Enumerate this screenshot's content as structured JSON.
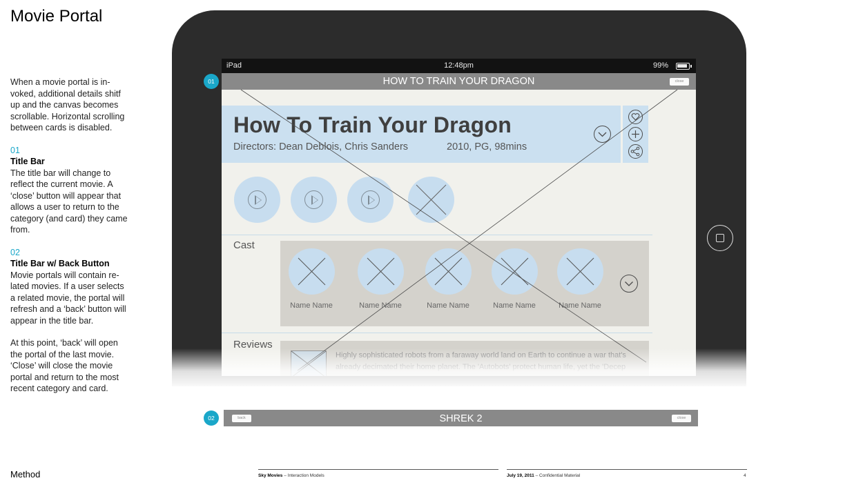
{
  "page": {
    "title": "Movie Portal",
    "intro": "When a movie portal is in-voked, additional details shitf up and the canvas becomes scrollable. Horizontal scrolling between cards is disabled.",
    "notes": [
      {
        "num": "01",
        "heading": "Title Bar",
        "body": "The title bar will change to reflect the current movie. A ‘close’ button will appear that allows a user to return to the category (and card) they came from."
      },
      {
        "num": "02",
        "heading": "Title Bar w/ Back Button",
        "body": "Movie portals will contain re-lated movies. If a user selects a related movie, the portal will refresh and a ‘back’ button will appear in the title bar."
      }
    ],
    "closing_note": "At this point, ‘back’ will open the portal of the last movie. ‘Close’ will close the movie portal and return to the most recent category and card.",
    "method_label": "Method"
  },
  "footer": {
    "left_brand": "Sky Movies",
    "left_doc": " – Interaction Models",
    "date": "July 19, 2011",
    "confidential": " – Confidential Material",
    "page_number": "4"
  },
  "device": {
    "carrier": "iPad",
    "time": "12:48pm",
    "battery": "99%"
  },
  "portal": {
    "titlebar_title": "HOW TO TRAIN YOUR DRAGON",
    "close_label": "close",
    "movie_title": "How To Train Your Dragon",
    "directors": "Directors: Dean Deblois, Chris Sanders",
    "info": "2010, PG, 98mins",
    "cast_label": "Cast",
    "cast": [
      "Name Name",
      "Name Name",
      "Name Name",
      "Name Name",
      "Name Name"
    ],
    "reviews_label": "Reviews",
    "review_text": "Highly sophisticated robots from a faraway world land on Earth to continue a war that's already decimated their home planet. The 'Autobots' protect human life, yet the 'Decep"
  },
  "titlebar2": {
    "back_label": "back",
    "title": "SHREK 2",
    "close_label": "close"
  },
  "badges": [
    "01",
    "02"
  ],
  "colors": {
    "accent": "#1aa7c9",
    "titlebar": "#898989",
    "panel_blue": "#cbe0f0",
    "panel_gray": "#d4d2cc"
  }
}
